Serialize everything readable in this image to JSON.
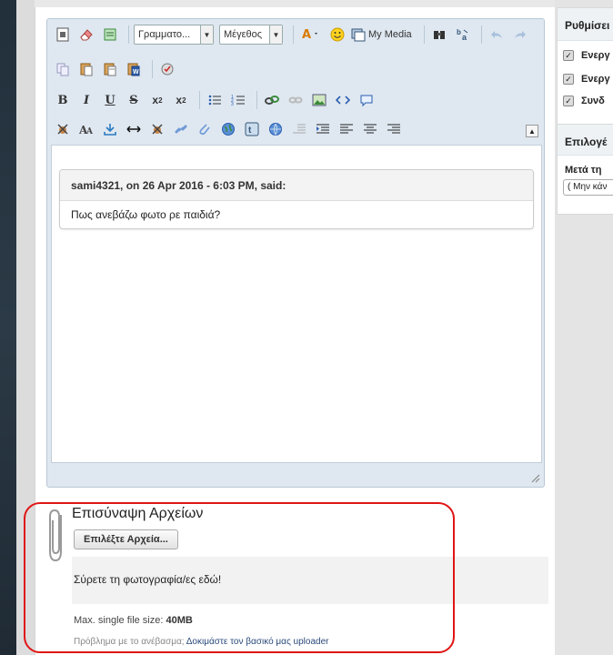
{
  "toolbar": {
    "font_select": "Γραμματο...",
    "size_select": "Μέγεθος",
    "my_media": "My Media",
    "bold": "B",
    "italic": "I",
    "underline": "U",
    "strike": "S",
    "sub": "x",
    "sub_script": "2",
    "sup": "x",
    "sup_script": "2",
    "collapse": "▲"
  },
  "quote": {
    "header": "sami4321, on 26 Apr 2016 - 6:03 PM, said:",
    "body": "Πως ανεβάζω φωτο ρε παιδιά?"
  },
  "attachments": {
    "title": "Επισύναψη Αρχείων",
    "choose_button": "Επιλέξτε Αρχεία...",
    "dropzone_text": "Σύρετε τη φωτογραφία/ες εδώ!",
    "max_size_label": "Max. single file size: ",
    "max_size_value": "40MB",
    "problem_text": "Πρόβλημα με το ανέβασμα; ",
    "problem_link": "Δοκιμάστε τον βασικό μας uploader"
  },
  "sidebar": {
    "settings_title": "Ρυθμίσει",
    "checks": [
      "Ενεργ",
      "Ενεργ",
      "Συνδ"
    ],
    "options_title": "Επιλογέ",
    "after_label": "Μετά τη",
    "after_select": "( Μην κάν"
  },
  "colors": {
    "highlight_outline": "#e01515",
    "editor_bg": "#dfe8f1",
    "link": "#2a4a7a"
  }
}
